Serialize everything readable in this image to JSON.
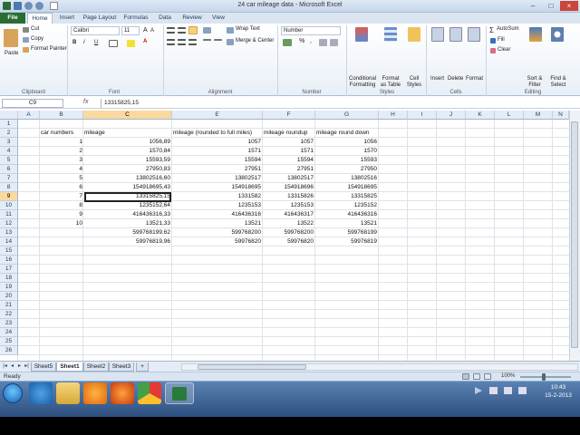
{
  "window": {
    "title": "24 car mileage data - Microsoft Excel"
  },
  "ribbon": {
    "tabs": [
      "File",
      "Home",
      "Insert",
      "Page Layout",
      "Formulas",
      "Data",
      "Review",
      "View"
    ],
    "clipboard": {
      "paste": "Paste",
      "cut": "Cut",
      "copy": "Copy",
      "format_painter": "Format Painter",
      "label": "Clipboard"
    },
    "font": {
      "name": "Calibri",
      "size": "11",
      "bold": "B",
      "italic": "I",
      "underline": "U",
      "label": "Font"
    },
    "alignment": {
      "wrap_text": "Wrap Text",
      "merge_center": "Merge & Center",
      "label": "Alignment"
    },
    "number": {
      "format": "Number",
      "label": "Number"
    },
    "styles": {
      "conditional": "Conditional Formatting",
      "format_table": "Format as Table",
      "cell_styles": "Cell Styles",
      "label": "Styles"
    },
    "cells": {
      "insert": "Insert",
      "delete": "Delete",
      "format": "Format",
      "label": "Cells"
    },
    "editing": {
      "autosum": "AutoSum",
      "fill": "Fill",
      "clear": "Clear",
      "sort_filter": "Sort & Filter",
      "find_select": "Find & Select",
      "label": "Editing"
    }
  },
  "formula_bar": {
    "name_box": "C9",
    "fx": "fx",
    "value": "13315825,15"
  },
  "columns": [
    "A",
    "B",
    "C",
    "E",
    "F",
    "G",
    "H",
    "I",
    "J",
    "K",
    "L",
    "M",
    "N"
  ],
  "selected_column": "C",
  "rows": [
    "1",
    "2",
    "3",
    "4",
    "5",
    "6",
    "7",
    "8",
    "9",
    "10",
    "11",
    "12",
    "13",
    "14",
    "15",
    "16",
    "17",
    "18",
    "19",
    "20",
    "21",
    "22",
    "23",
    "24",
    "25",
    "26"
  ],
  "selected_row": "9",
  "table": {
    "headers": [
      "car numbers",
      "mileage",
      "mileage (rounded to full miles)",
      "mileage roundup",
      "mileage round down"
    ],
    "rows": [
      [
        "1",
        "1056,89",
        "1057",
        "1057",
        "1056"
      ],
      [
        "2",
        "1570,84",
        "1571",
        "1571",
        "1570"
      ],
      [
        "3",
        "15593,59",
        "15594",
        "15594",
        "15593"
      ],
      [
        "4",
        "27950,83",
        "27951",
        "27951",
        "27950"
      ],
      [
        "5",
        "13802516,60",
        "13802517",
        "13802517",
        "13802516"
      ],
      [
        "6",
        "154918695,43",
        "154918695",
        "154918696",
        "154918695"
      ],
      [
        "7",
        "13315825,15",
        "1331582",
        "13315826",
        "13315825"
      ],
      [
        "8",
        "1235152,64",
        "1235153",
        "1235153",
        "1235152"
      ],
      [
        "9",
        "416436316,33",
        "416436316",
        "416436317",
        "416436316"
      ],
      [
        "10",
        "13521,33",
        "13521",
        "13522",
        "13521"
      ],
      [
        "",
        "599768199,62",
        "599768200",
        "599768200",
        "599768199"
      ],
      [
        "",
        "59976819,96",
        "59976820",
        "59976820",
        "59976819"
      ]
    ]
  },
  "sheets": [
    "Sheet5",
    "Sheet1",
    "Sheet2",
    "Sheet3"
  ],
  "active_sheet": "Sheet1",
  "status": {
    "ready": "Ready",
    "zoom": "100%"
  },
  "taskbar": {
    "time": "10:43",
    "date": "15-2-2013"
  },
  "colors": {
    "excel_green": "#2a6d34",
    "ribbon_bg": "#dbe5f1",
    "selection": "#f9d99f",
    "taskbar": "#2c4f7f"
  }
}
